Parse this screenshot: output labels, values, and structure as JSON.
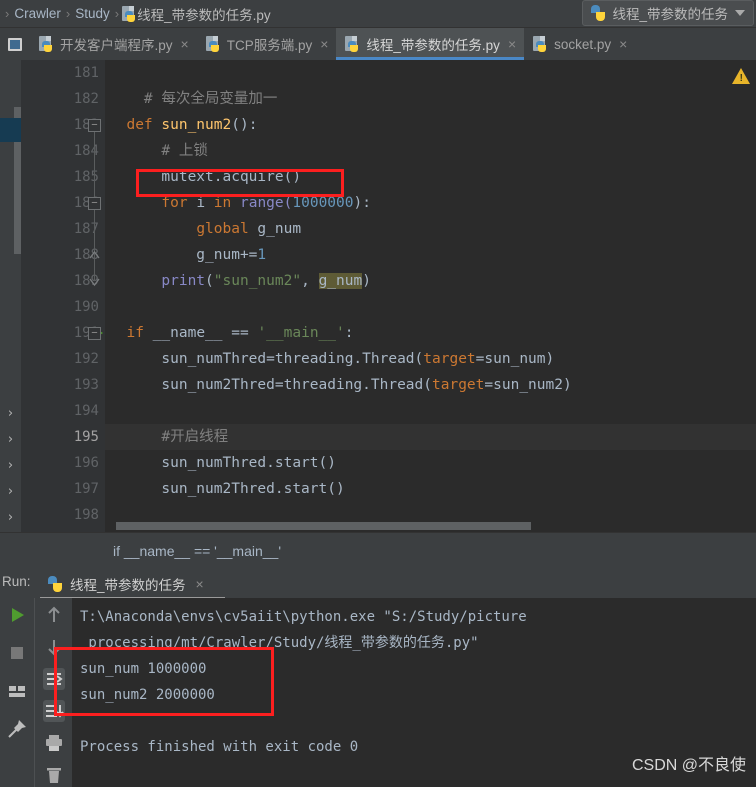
{
  "navbar": {
    "breadcrumbs": [
      "Crawler",
      "Study"
    ],
    "file": "线程_带参数的任务.py",
    "separator": "›",
    "run_config": "线程_带参数的任务",
    "file_icon": "python-file-icon",
    "caret_icon": "chevron-down-icon"
  },
  "tabs": [
    {
      "label": "开发客户端程序.py",
      "active": false,
      "close": "×"
    },
    {
      "label": "TCP服务端.py",
      "active": false,
      "close": "×"
    },
    {
      "label": "线程_带参数的任务.py",
      "active": true,
      "close": "×"
    },
    {
      "label": "socket.py",
      "active": false,
      "close": "×"
    }
  ],
  "editor": {
    "first_line": 181,
    "current_line": 195,
    "run_marker_line": 191,
    "line_numbers": [
      181,
      182,
      183,
      184,
      185,
      186,
      187,
      188,
      189,
      190,
      191,
      192,
      193,
      194,
      195,
      196,
      197,
      198
    ],
    "lines": [
      {
        "n": 181,
        "segments": []
      },
      {
        "n": 182,
        "segments": [
          {
            "t": "    # 每次全局变量加一",
            "c": "cmt"
          }
        ]
      },
      {
        "n": 183,
        "segments": [
          {
            "t": "  ",
            "c": "ident"
          },
          {
            "t": "def ",
            "c": "kw"
          },
          {
            "t": "sun_num2",
            "c": "fn"
          },
          {
            "t": "():",
            "c": "ident"
          }
        ]
      },
      {
        "n": 184,
        "segments": [
          {
            "t": "      # 上锁",
            "c": "cmt"
          }
        ]
      },
      {
        "n": 185,
        "segments": [
          {
            "t": "      mutext.acquire()",
            "c": "ident"
          }
        ]
      },
      {
        "n": 186,
        "segments": [
          {
            "t": "      ",
            "c": "ident"
          },
          {
            "t": "for ",
            "c": "kw"
          },
          {
            "t": "i ",
            "c": "ident"
          },
          {
            "t": "in ",
            "c": "kw"
          },
          {
            "t": "range(",
            "c": "bi"
          },
          {
            "t": "1000000",
            "c": "num"
          },
          {
            "t": "):",
            "c": "ident"
          }
        ]
      },
      {
        "n": 187,
        "segments": [
          {
            "t": "          ",
            "c": "ident"
          },
          {
            "t": "global ",
            "c": "kw"
          },
          {
            "t": "g_num",
            "c": "ident"
          }
        ]
      },
      {
        "n": 188,
        "segments": [
          {
            "t": "          g_num",
            "c": "ident"
          },
          {
            "t": "+=",
            "c": "ident"
          },
          {
            "t": "1",
            "c": "num"
          }
        ]
      },
      {
        "n": 189,
        "segments": [
          {
            "t": "      ",
            "c": "ident"
          },
          {
            "t": "print",
            "c": "bi"
          },
          {
            "t": "(",
            "c": "ident"
          },
          {
            "t": "\"sun_num2\"",
            "c": "str"
          },
          {
            "t": ", ",
            "c": "ident"
          },
          {
            "t": "g_num",
            "c": "hl-ident"
          },
          {
            "t": ")",
            "c": "ident"
          }
        ]
      },
      {
        "n": 190,
        "segments": []
      },
      {
        "n": 191,
        "segments": [
          {
            "t": "  ",
            "c": "ident"
          },
          {
            "t": "if ",
            "c": "kw"
          },
          {
            "t": "__name__ ",
            "c": "ident"
          },
          {
            "t": "== ",
            "c": "ident"
          },
          {
            "t": "'__main__'",
            "c": "str"
          },
          {
            "t": ":",
            "c": "ident"
          }
        ]
      },
      {
        "n": 192,
        "segments": [
          {
            "t": "      sun_numThred=threading.Thread(",
            "c": "ident"
          },
          {
            "t": "target",
            "c": "kwarg"
          },
          {
            "t": "=sun_num)",
            "c": "ident"
          }
        ]
      },
      {
        "n": 193,
        "segments": [
          {
            "t": "      sun_num2Thred=threading.Thread(",
            "c": "ident"
          },
          {
            "t": "target",
            "c": "kwarg"
          },
          {
            "t": "=sun_num2)",
            "c": "ident"
          }
        ]
      },
      {
        "n": 194,
        "segments": []
      },
      {
        "n": 195,
        "segments": [
          {
            "t": "      #开启线程",
            "c": "cmt"
          }
        ]
      },
      {
        "n": 196,
        "segments": [
          {
            "t": "      sun_numThred.start()",
            "c": "ident"
          }
        ]
      },
      {
        "n": 197,
        "segments": [
          {
            "t": "      sun_num2Thred.start()",
            "c": "ident"
          }
        ]
      },
      {
        "n": 198,
        "segments": []
      }
    ],
    "warning_icon": "warning-triangle-icon"
  },
  "statusbar": {
    "structure_text": "if __name__ == '__main__'"
  },
  "run_panel": {
    "label": "Run:",
    "tab_title": "线程_带参数的任务",
    "tab_close": "×",
    "tool_icons": [
      "run-icon",
      "stop-icon",
      "layout-icon",
      "pin-icon",
      "scroll-up-icon",
      "scroll-down-icon",
      "soft-wrap-icon",
      "scroll-to-end-icon",
      "print-icon",
      "trash-icon"
    ],
    "console": [
      "T:\\Anaconda\\envs\\cv5aiit\\python.exe \"S:/Study/picture",
      " processing/mt/Crawler/Study/线程_带参数的任务.py\"",
      "sun_num 1000000",
      "sun_num2 2000000",
      "",
      "Process finished with exit code 0"
    ]
  },
  "watermark": "CSDN @不良使",
  "colors": {
    "annotation_red": "#fc1f1f",
    "tab_active_underline": "#4a88c7",
    "editor_bg": "#2b2b2b",
    "chrome_bg": "#3c3f41",
    "keyword": "#cc7832",
    "function": "#ffc66d",
    "string": "#6a8759",
    "number": "#6897bb",
    "comment": "#808080",
    "builtin": "#8888c6",
    "default_text": "#a9b7c6"
  }
}
